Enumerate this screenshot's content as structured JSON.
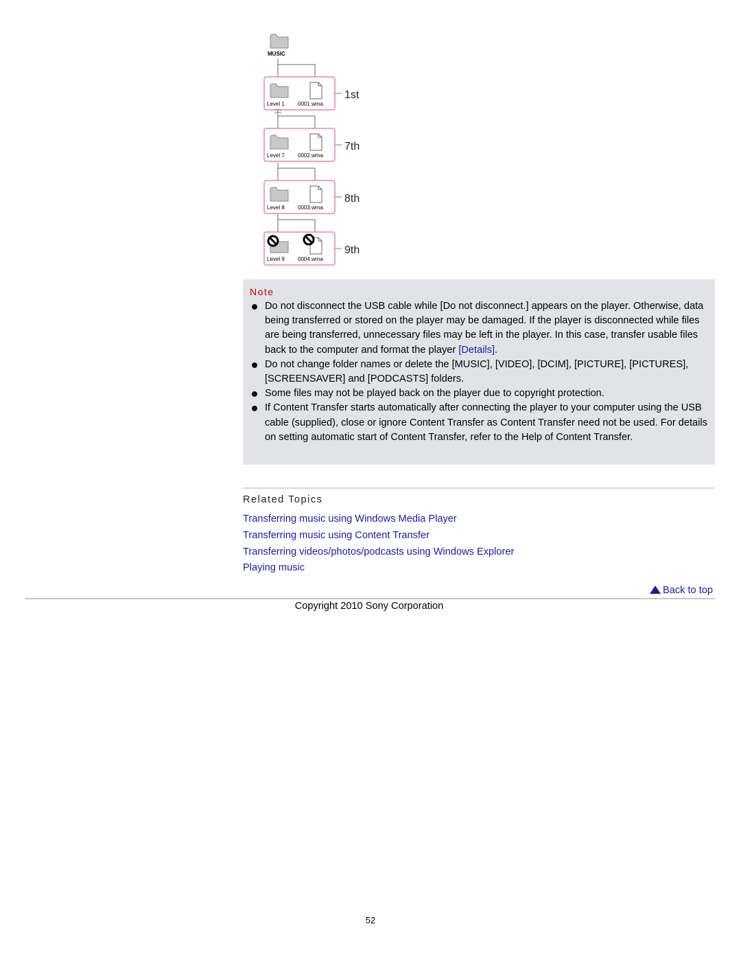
{
  "diagram": {
    "root_label": "MUSIC",
    "levels": [
      {
        "folder": "Level 1",
        "file": "0001.wma",
        "ordinal": "1st",
        "blocked": false
      },
      {
        "folder": "Level 7",
        "file": "0002.wma",
        "ordinal": "7th",
        "blocked": false
      },
      {
        "folder": "Level 8",
        "file": "0003.wma",
        "ordinal": "8th",
        "blocked": false
      },
      {
        "folder": "Level 9",
        "file": "0004.wma",
        "ordinal": "9th",
        "blocked": true
      }
    ],
    "colors": {
      "frame": "#ee80b8",
      "folder": "#c8c8c8",
      "line": "#666666"
    }
  },
  "note": {
    "title": "Note",
    "items": [
      {
        "text": "Do not disconnect the USB cable while [Do not disconnect.] appears on the player. Otherwise, data being transferred or stored on the player may be damaged. If the player is disconnected while files are being transferred, unnecessary files may be left in the player. In this case, transfer usable files back to the computer and format the player ",
        "link": "[Details]",
        "suffix": "."
      },
      {
        "text": "Do not change folder names or delete the [MUSIC], [VIDEO], [DCIM], [PICTURE], [PICTURES], [SCREENSAVER] and [PODCASTS] folders."
      },
      {
        "text": "Some files may not be played back on the player due to copyright protection."
      },
      {
        "text": "If Content Transfer starts automatically after connecting the player to your computer using the USB cable (supplied), close or ignore Content Transfer as Content Transfer need not be used. For details on setting automatic start of Content Transfer, refer to the Help of Content Transfer."
      }
    ]
  },
  "related": {
    "title": "Related Topics",
    "links": [
      "Transferring music using Windows Media Player",
      "Transferring music using Content Transfer",
      "Transferring videos/photos/podcasts using Windows Explorer",
      "Playing music"
    ]
  },
  "footer": {
    "back_to_top": "Back to top",
    "copyright": "Copyright 2010 Sony Corporation",
    "page_number": "52"
  }
}
